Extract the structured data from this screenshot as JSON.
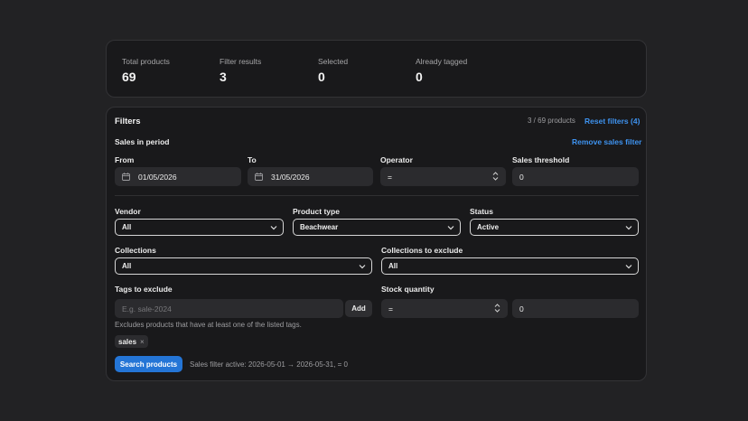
{
  "stats": [
    {
      "label": "Total products",
      "value": "69"
    },
    {
      "label": "Filter results",
      "value": "3"
    },
    {
      "label": "Selected",
      "value": "0"
    },
    {
      "label": "Already tagged",
      "value": "0"
    }
  ],
  "filters": {
    "title": "Filters",
    "count": "3 / 69 products",
    "reset_label": "Reset filters (4)",
    "sales_period_title": "Sales in period",
    "remove_sales_label": "Remove sales filter",
    "from_label": "From",
    "from_value": "01/05/2026",
    "to_label": "To",
    "to_value": "31/05/2026",
    "operator_label": "Operator",
    "operator_value": "=",
    "threshold_label": "Sales threshold",
    "threshold_value": "0",
    "vendor_label": "Vendor",
    "vendor_value": "All",
    "product_type_label": "Product type",
    "product_type_value": "Beachwear",
    "status_label": "Status",
    "status_value": "Active",
    "collections_label": "Collections",
    "collections_value": "All",
    "collections_exclude_label": "Collections to exclude",
    "collections_exclude_value": "All",
    "tags_exclude_label": "Tags to exclude",
    "tags_placeholder": "E.g. sale-2024",
    "add_label": "Add",
    "tags_hint": "Excludes products that have at least one of the listed tags.",
    "tag_chip": "sales",
    "tag_chip_remove": "×",
    "stock_label": "Stock quantity",
    "stock_operator": "=",
    "stock_value": "0",
    "search_label": "Search products",
    "sales_active_text": "Sales filter active: 2026-05-01 → 2026-05-31, = 0"
  }
}
